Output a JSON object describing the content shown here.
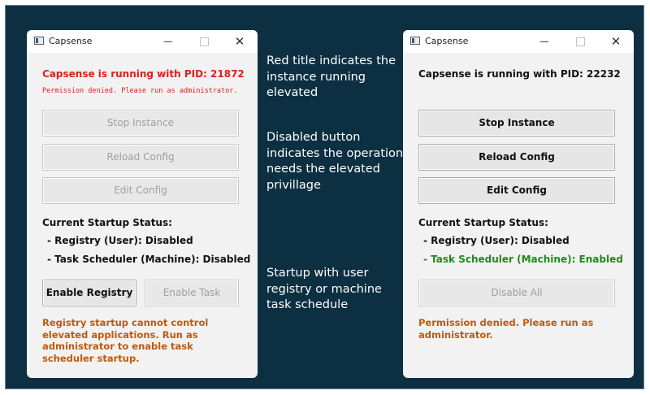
{
  "left_window": {
    "title": "Capsense",
    "status": "Capsense is running with PID: 21872",
    "permission_note": "Permission denied. Please run as administrator.",
    "buttons": {
      "stop": "Stop Instance",
      "reload": "Reload Config",
      "edit": "Edit Config",
      "enable_registry": "Enable Registry",
      "enable_task": "Enable Task"
    },
    "startup": {
      "heading": "Current Startup Status:",
      "registry": "- Registry (User): Disabled",
      "task": "- Task Scheduler (Machine): Disabled"
    },
    "warning": "Registry startup cannot control elevated applications. Run as administrator to enable task scheduler startup."
  },
  "right_window": {
    "title": "Capsense",
    "status": "Capsense is running with PID: 22232",
    "buttons": {
      "stop": "Stop Instance",
      "reload": "Reload Config",
      "edit": "Edit Config",
      "disable_all": "Disable All"
    },
    "startup": {
      "heading": "Current Startup Status:",
      "registry": "- Registry (User): Disabled",
      "task": "- Task Scheduler (Machine): Enabled"
    },
    "warning": "Permission denied. Please run as administrator."
  },
  "captions": {
    "red_title": "Red title indicates the instance running elevated",
    "disabled_button": "Disabled button indicates the operation needs the elevated privillage",
    "startup": "Startup with user registry or machine task schedule"
  },
  "colors": {
    "background": "#0d2f42",
    "elevated_red": "#e0201b",
    "enabled_green": "#1f8a1f",
    "warning_orange": "#c0590b",
    "disabled_gray": "#a0a0a0"
  },
  "icons": [
    "app-icon",
    "minimize-icon",
    "maximize-icon",
    "close-icon"
  ]
}
